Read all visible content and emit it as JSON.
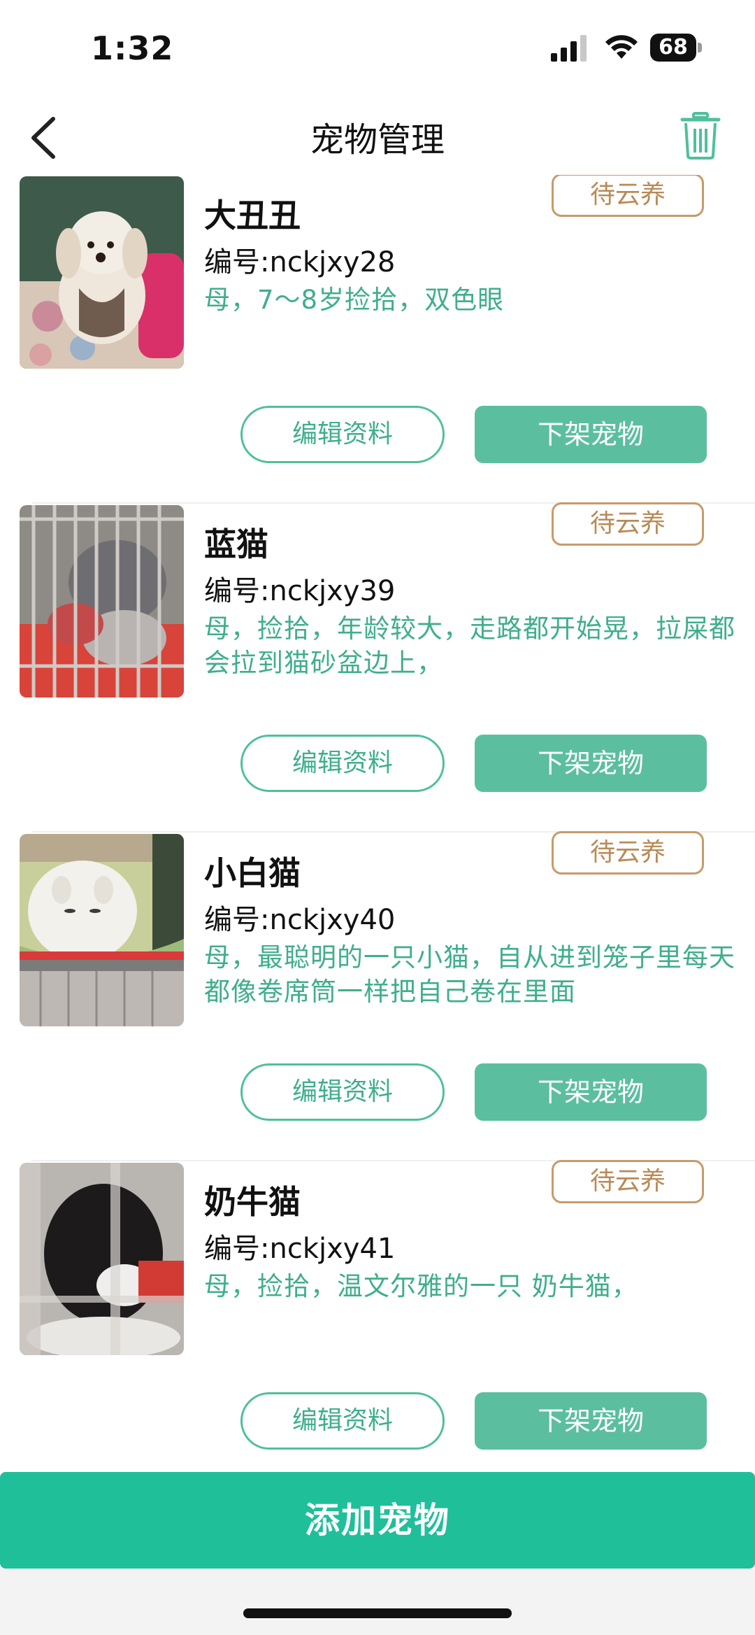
{
  "status_bar": {
    "time": "1:32",
    "battery": "68"
  },
  "nav": {
    "title": "宠物管理"
  },
  "colors": {
    "accent": "#1fbf9a",
    "button_green": "#5bbf9f",
    "desc_text": "#3fae8c",
    "status_border": "#c89a6a"
  },
  "pets": [
    {
      "name": "大丑丑",
      "id": "编号:nckjxy28",
      "desc": "母，7～8岁捡拾，双色眼",
      "status": "待云养",
      "edit_label": "编辑资料",
      "offline_label": "下架宠物",
      "photo": "white-dog-photo"
    },
    {
      "name": "蓝猫",
      "id": "编号:nckjxy39",
      "desc": "母，捡拾，年龄较大，走路都开始晃，拉屎都会拉到猫砂盆边上，",
      "status": "待云养",
      "edit_label": "编辑资料",
      "offline_label": "下架宠物",
      "photo": "grey-cat-cage-photo"
    },
    {
      "name": "小白猫",
      "id": "编号:nckjxy40",
      "desc": "母，最聪明的一只小猫，自从进到笼子里每天都像卷席筒一样把自己卷在里面",
      "status": "待云养",
      "edit_label": "编辑资料",
      "offline_label": "下架宠物",
      "photo": "white-cat-photo"
    },
    {
      "name": "奶牛猫",
      "id": "编号:nckjxy41",
      "desc": "母，捡拾，温文尔雅的一只 奶牛猫，",
      "status": "待云养",
      "edit_label": "编辑资料",
      "offline_label": "下架宠物",
      "photo": "tuxedo-cat-photo"
    }
  ],
  "footer": {
    "add_label": "添加宠物"
  }
}
